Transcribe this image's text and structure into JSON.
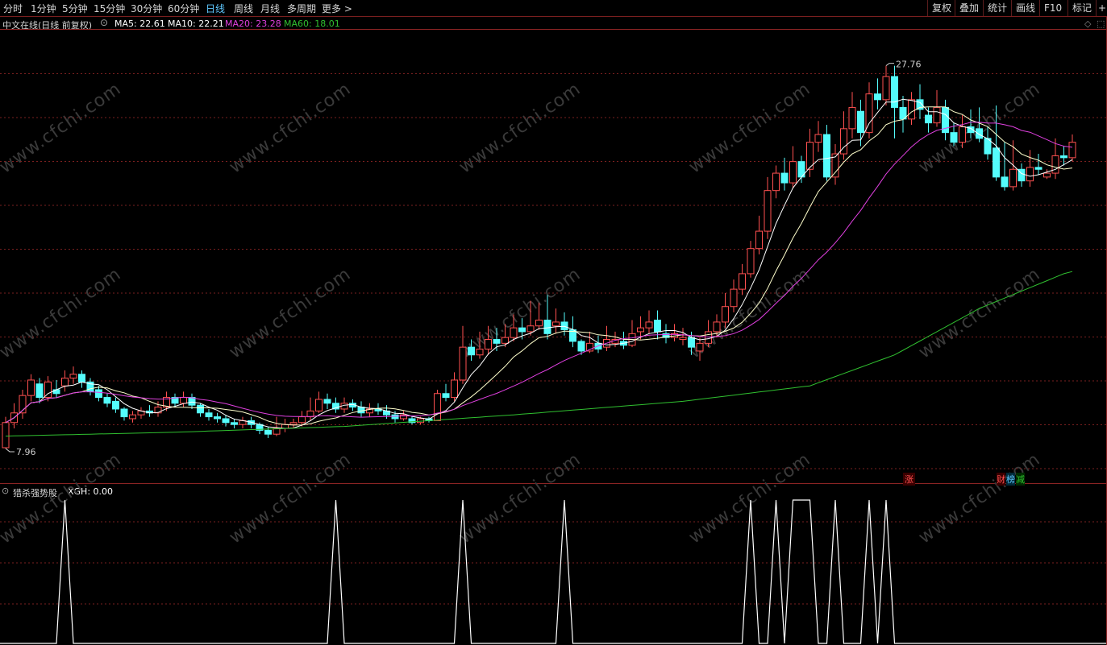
{
  "toolbar": {
    "tabs": [
      "分时",
      "1分钟",
      "5分钟",
      "15分钟",
      "30分钟",
      "60分钟",
      "日线",
      "周线",
      "月线",
      "多周期",
      "更多 >"
    ],
    "active_tab": "日线",
    "right_buttons": [
      "复权",
      "叠加",
      "统计",
      "画线",
      "F10",
      "标记",
      "+自"
    ]
  },
  "header": {
    "stock": "中文在线(日线 前复权)",
    "ma5": "MA5: 22.61",
    "ma10": "MA10: 22.21",
    "ma20": "MA20: 23.28",
    "ma60": "MA60: 18.01"
  },
  "indicator": {
    "label": "猎杀强势股",
    "value": "XGH: 0.00"
  },
  "markers": {
    "zhang": "涨",
    "cai": "财",
    "bang": "榜",
    "jian": "减"
  },
  "watermark": "www.cfchi.com",
  "colors": {
    "up": "#ff5050",
    "down": "#54fcfc",
    "ma5": "#ffffff",
    "ma10": "#ffffcc",
    "ma20": "#e040e0",
    "ma60": "#30c030",
    "grid": "#7a1f1f",
    "signal": "#ffffff"
  },
  "chart_data": [
    {
      "type": "candlestick",
      "title": "中文在线(日线 前复权)",
      "max_label": "27.76",
      "min_label": "7.96",
      "ylim": [
        7.0,
        29.2
      ],
      "candles": [
        [
          8.0,
          9.3,
          7.96,
          9.6
        ],
        [
          9.3,
          9.8,
          9.0,
          10.3
        ],
        [
          9.8,
          10.7,
          9.5,
          11.0
        ],
        [
          10.7,
          11.5,
          10.4,
          11.8
        ],
        [
          11.3,
          10.6,
          10.3,
          11.6
        ],
        [
          10.6,
          11.4,
          10.4,
          11.7
        ],
        [
          11.0,
          10.8,
          10.6,
          11.5
        ],
        [
          11.2,
          11.6,
          10.9,
          12.0
        ],
        [
          11.6,
          11.8,
          11.3,
          12.2
        ],
        [
          11.8,
          11.4,
          11.1,
          12.0
        ],
        [
          11.4,
          10.9,
          10.7,
          11.6
        ],
        [
          11.0,
          10.6,
          10.4,
          11.2
        ],
        [
          10.6,
          10.3,
          10.1,
          10.8
        ],
        [
          10.4,
          10.0,
          9.8,
          10.6
        ],
        [
          10.0,
          9.6,
          9.4,
          10.1
        ],
        [
          9.5,
          9.7,
          9.3,
          9.9
        ],
        [
          9.7,
          9.9,
          9.5,
          10.1
        ],
        [
          9.9,
          9.8,
          9.6,
          10.2
        ],
        [
          9.8,
          10.1,
          9.6,
          10.4
        ],
        [
          10.1,
          10.6,
          9.9,
          10.9
        ],
        [
          10.6,
          10.3,
          10.1,
          10.8
        ],
        [
          10.3,
          10.6,
          10.1,
          10.9
        ],
        [
          10.6,
          10.2,
          10.0,
          10.8
        ],
        [
          10.2,
          9.8,
          9.6,
          10.3
        ],
        [
          9.8,
          9.6,
          9.4,
          10.0
        ],
        [
          9.6,
          9.5,
          9.3,
          9.8
        ],
        [
          9.5,
          9.3,
          9.1,
          9.7
        ],
        [
          9.3,
          9.2,
          9.0,
          9.5
        ],
        [
          9.2,
          9.4,
          9.0,
          9.6
        ],
        [
          9.4,
          9.2,
          9.0,
          9.6
        ],
        [
          9.2,
          8.9,
          8.7,
          9.3
        ],
        [
          8.9,
          8.7,
          8.5,
          9.1
        ],
        [
          8.7,
          9.0,
          8.6,
          9.6
        ],
        [
          9.0,
          9.2,
          8.8,
          9.5
        ],
        [
          9.2,
          9.3,
          9.0,
          9.5
        ],
        [
          9.3,
          9.6,
          9.1,
          9.9
        ],
        [
          9.6,
          9.9,
          9.4,
          10.6
        ],
        [
          9.9,
          10.5,
          9.8,
          10.9
        ],
        [
          10.5,
          10.3,
          10.0,
          10.8
        ],
        [
          10.3,
          10.0,
          9.8,
          10.6
        ],
        [
          10.0,
          10.3,
          9.8,
          10.6
        ],
        [
          10.3,
          10.1,
          9.9,
          10.5
        ],
        [
          10.1,
          9.8,
          9.6,
          10.4
        ],
        [
          9.8,
          10.0,
          9.6,
          10.3
        ],
        [
          10.0,
          9.9,
          9.7,
          10.3
        ],
        [
          9.9,
          9.7,
          9.5,
          10.2
        ],
        [
          9.7,
          9.5,
          9.3,
          9.9
        ],
        [
          9.5,
          9.7,
          9.4,
          9.9
        ],
        [
          9.5,
          9.3,
          9.2,
          9.6
        ],
        [
          9.3,
          9.5,
          9.2,
          9.6
        ],
        [
          9.5,
          9.4,
          9.3,
          9.6
        ],
        [
          9.4,
          10.8,
          9.4,
          11.0
        ],
        [
          10.8,
          10.6,
          10.4,
          11.3
        ],
        [
          10.6,
          11.5,
          10.4,
          11.9
        ],
        [
          11.5,
          13.2,
          11.3,
          14.3
        ],
        [
          13.2,
          12.8,
          12.5,
          13.6
        ],
        [
          12.8,
          13.1,
          12.6,
          14.0
        ],
        [
          13.1,
          13.6,
          12.8,
          14.3
        ],
        [
          13.6,
          13.4,
          13.0,
          14.2
        ],
        [
          13.4,
          13.7,
          13.2,
          14.4
        ],
        [
          13.7,
          14.2,
          13.5,
          14.9
        ],
        [
          14.2,
          14.0,
          13.6,
          14.7
        ],
        [
          14.0,
          14.3,
          13.8,
          15.6
        ],
        [
          14.3,
          14.6,
          14.1,
          15.5
        ],
        [
          14.6,
          13.9,
          13.6,
          15.9
        ],
        [
          14.3,
          14.5,
          13.9,
          15.2
        ],
        [
          14.5,
          14.1,
          13.8,
          15.0
        ],
        [
          14.1,
          13.5,
          13.2,
          14.8
        ],
        [
          13.5,
          13.0,
          12.8,
          13.6
        ],
        [
          13.0,
          13.4,
          12.9,
          14.0
        ],
        [
          13.4,
          13.1,
          12.9,
          13.8
        ],
        [
          13.2,
          13.6,
          13.0,
          14.3
        ],
        [
          13.4,
          13.6,
          13.2,
          14.0
        ],
        [
          13.5,
          13.3,
          13.1,
          14.0
        ],
        [
          13.3,
          13.9,
          13.2,
          14.6
        ],
        [
          14.0,
          14.2,
          13.6,
          14.8
        ],
        [
          14.2,
          14.5,
          13.9,
          15.1
        ],
        [
          14.6,
          14.0,
          13.6,
          15.1
        ],
        [
          13.9,
          13.7,
          13.4,
          14.4
        ],
        [
          13.7,
          13.9,
          13.5,
          14.4
        ],
        [
          13.6,
          13.7,
          13.3,
          14.2
        ],
        [
          13.7,
          13.2,
          12.8,
          14.0
        ],
        [
          13.0,
          13.4,
          12.5,
          13.7
        ],
        [
          13.4,
          14.0,
          13.2,
          14.6
        ],
        [
          14.0,
          14.5,
          13.7,
          14.9
        ],
        [
          14.5,
          15.3,
          14.2,
          16.0
        ],
        [
          15.3,
          16.2,
          15.0,
          16.7
        ],
        [
          16.2,
          17.0,
          15.9,
          17.5
        ],
        [
          17.0,
          18.3,
          16.8,
          18.7
        ],
        [
          18.3,
          19.2,
          18.0,
          20.0
        ],
        [
          19.2,
          21.3,
          18.8,
          22.0
        ],
        [
          21.3,
          22.2,
          20.9,
          22.6
        ],
        [
          22.2,
          21.7,
          21.3,
          23.0
        ],
        [
          21.7,
          22.8,
          21.4,
          23.6
        ],
        [
          22.8,
          22.0,
          21.7,
          23.1
        ],
        [
          22.4,
          23.8,
          22.0,
          24.5
        ],
        [
          23.8,
          24.2,
          23.3,
          24.9
        ],
        [
          24.2,
          22.0,
          21.8,
          24.7
        ],
        [
          22.0,
          23.2,
          21.6,
          23.7
        ],
        [
          23.2,
          24.5,
          22.9,
          25.4
        ],
        [
          24.5,
          25.6,
          24.0,
          26.4
        ],
        [
          25.4,
          24.3,
          23.6,
          26.0
        ],
        [
          24.3,
          26.3,
          24.0,
          26.9
        ],
        [
          26.3,
          26.0,
          25.5,
          27.1
        ],
        [
          26.0,
          27.2,
          25.7,
          27.76
        ],
        [
          27.2,
          25.6,
          24.0,
          27.76
        ],
        [
          25.6,
          25.0,
          24.3,
          26.2
        ],
        [
          25.0,
          26.0,
          24.7,
          26.4
        ],
        [
          26.0,
          25.5,
          25.0,
          26.8
        ],
        [
          25.2,
          24.8,
          24.3,
          25.6
        ],
        [
          24.8,
          25.6,
          24.6,
          26.5
        ],
        [
          25.6,
          24.3,
          23.9,
          26.0
        ],
        [
          24.3,
          23.8,
          23.6,
          24.8
        ],
        [
          23.8,
          24.6,
          23.5,
          25.2
        ],
        [
          24.6,
          24.3,
          24.0,
          25.5
        ],
        [
          24.5,
          24.0,
          23.8,
          25.6
        ],
        [
          24.0,
          23.2,
          22.9,
          24.6
        ],
        [
          23.5,
          22.0,
          21.8,
          25.7
        ],
        [
          22.0,
          21.5,
          21.3,
          23.8
        ],
        [
          21.5,
          22.4,
          21.3,
          23.9
        ],
        [
          22.4,
          21.8,
          21.5,
          22.7
        ],
        [
          21.8,
          22.5,
          21.5,
          23.4
        ],
        [
          22.5,
          22.4,
          22.1,
          23.2
        ],
        [
          22.0,
          22.2,
          21.9,
          22.4
        ],
        [
          22.2,
          23.1,
          21.9,
          24.0
        ],
        [
          23.1,
          23.0,
          22.6,
          23.6
        ],
        [
          23.0,
          23.8,
          22.8,
          24.2
        ]
      ],
      "ma60_anchors": [
        [
          0,
          8.6
        ],
        [
          20,
          8.8
        ],
        [
          40,
          9.1
        ],
        [
          60,
          9.7
        ],
        [
          80,
          10.4
        ],
        [
          95,
          11.2
        ],
        [
          105,
          12.8
        ],
        [
          115,
          15.2
        ],
        [
          125,
          17.0
        ],
        [
          134,
          18.01
        ]
      ]
    },
    {
      "type": "line",
      "name": "XGH",
      "ylim": [
        0,
        1
      ],
      "signal_runs": [
        [
          7,
          7
        ],
        [
          39,
          39
        ],
        [
          54,
          54
        ],
        [
          66,
          66
        ],
        [
          88,
          88
        ],
        [
          91,
          91
        ],
        [
          93,
          95
        ],
        [
          98,
          98
        ],
        [
          102,
          102
        ],
        [
          104,
          104
        ]
      ]
    }
  ]
}
